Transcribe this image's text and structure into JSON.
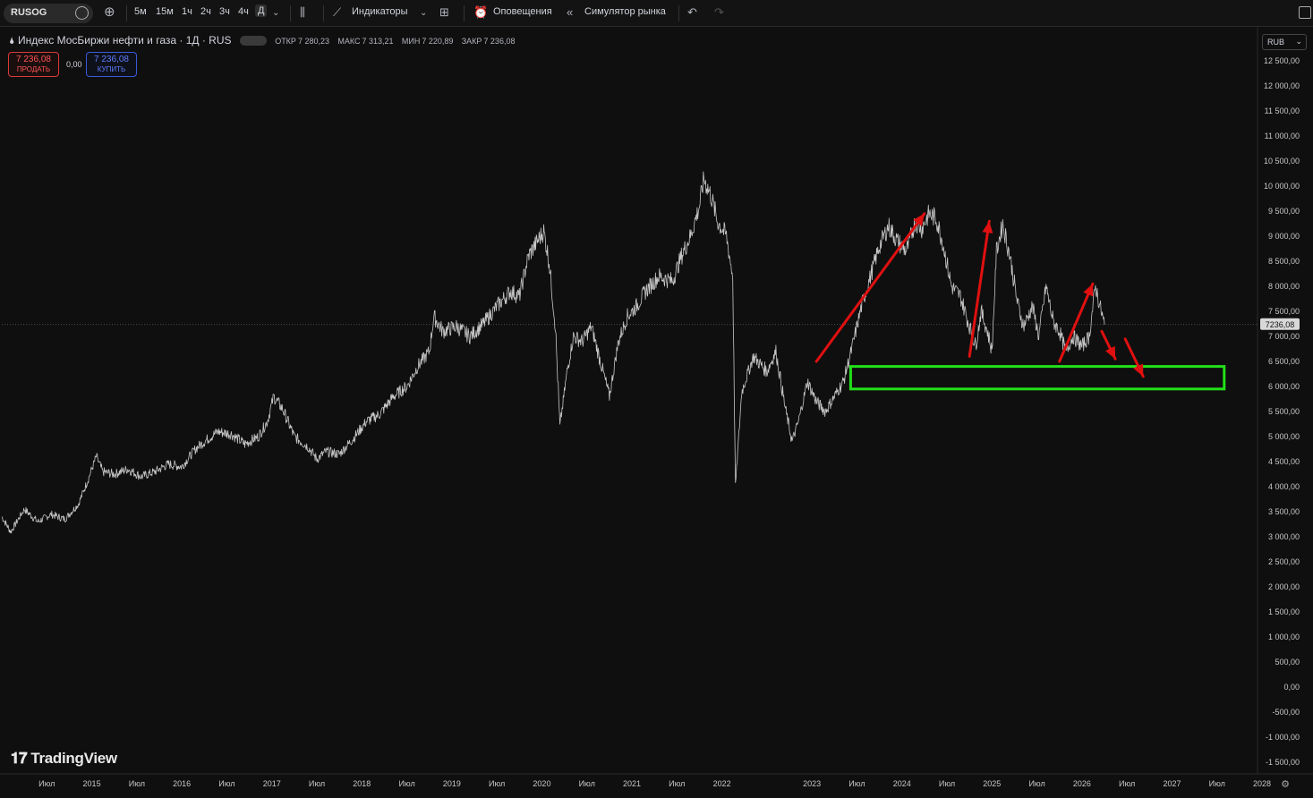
{
  "toolbar": {
    "symbol": "RUSOG",
    "intervals": [
      "5м",
      "15м",
      "1ч",
      "2ч",
      "3ч",
      "4ч",
      "Д"
    ],
    "active_interval": "Д",
    "indicators_label": "Индикаторы",
    "alerts_label": "Оповещения",
    "replay_label": "Симулятор рынка"
  },
  "legend": {
    "title": "Индекс МосБиржи нефти и газа · 1Д · RUS",
    "open_label": "ОТКР",
    "open": "7 280,23",
    "high_label": "МАКС",
    "high": "7 313,21",
    "low_label": "МИН",
    "low": "7 220,89",
    "close_label": "ЗАКР",
    "close": "7 236,08"
  },
  "trade": {
    "sell_price": "7 236,08",
    "sell_label": "ПРОДАТЬ",
    "spread": "0,00",
    "buy_price": "7 236,08",
    "buy_label": "КУПИТЬ"
  },
  "currency": "RUB",
  "brand": "TradingView",
  "colors": {
    "background": "#0f0f0f",
    "price_line": "#c8c8c8",
    "arrow": "#e01010",
    "zone": "#22e01a",
    "text": "#d1d4dc"
  },
  "chart_data": {
    "type": "line",
    "ylim": [
      -1500,
      12500
    ],
    "y_ticks": [
      "12 500,00",
      "12 000,00",
      "11 500,00",
      "11 000,00",
      "10 500,00",
      "10 000,00",
      "9 500,00",
      "9 000,00",
      "8 500,00",
      "8 000,00",
      "7 500,00",
      "7 000,00",
      "6 500,00",
      "6 000,00",
      "5 500,00",
      "5 000,00",
      "4 500,00",
      "4 000,00",
      "3 500,00",
      "3 000,00",
      "2 500,00",
      "2 000,00",
      "1 500,00",
      "1 000,00",
      "500,00",
      "0,00",
      "-500,00",
      "-1 000,00",
      "-1 500,00"
    ],
    "y_tick_values": [
      12500,
      12000,
      11500,
      11000,
      10500,
      10000,
      9500,
      9000,
      8500,
      8000,
      7500,
      7000,
      6500,
      6000,
      5500,
      5000,
      4500,
      4000,
      3500,
      3000,
      2500,
      2000,
      1500,
      1000,
      500,
      0,
      -500,
      -1000,
      -1500
    ],
    "x_ticks": [
      {
        "label": "Июл",
        "t": 2014.5
      },
      {
        "label": "2015",
        "t": 2015.0
      },
      {
        "label": "Июл",
        "t": 2015.5
      },
      {
        "label": "2016",
        "t": 2016.0
      },
      {
        "label": "Июл",
        "t": 2016.5
      },
      {
        "label": "2017",
        "t": 2017.0
      },
      {
        "label": "Июл",
        "t": 2017.5
      },
      {
        "label": "2018",
        "t": 2018.0
      },
      {
        "label": "Июл",
        "t": 2018.5
      },
      {
        "label": "2019",
        "t": 2019.0
      },
      {
        "label": "Июл",
        "t": 2019.5
      },
      {
        "label": "2020",
        "t": 2020.0
      },
      {
        "label": "Июл",
        "t": 2020.5
      },
      {
        "label": "2021",
        "t": 2021.0
      },
      {
        "label": "Июл",
        "t": 2021.5
      },
      {
        "label": "2022",
        "t": 2022.0
      },
      {
        "label": "2023",
        "t": 2023.0
      },
      {
        "label": "Июл",
        "t": 2023.5
      },
      {
        "label": "2024",
        "t": 2024.0
      },
      {
        "label": "Июл",
        "t": 2024.5
      },
      {
        "label": "2025",
        "t": 2025.0
      },
      {
        "label": "Июл",
        "t": 2025.5
      },
      {
        "label": "2026",
        "t": 2026.0
      },
      {
        "label": "Июл",
        "t": 2026.5
      },
      {
        "label": "2027",
        "t": 2027.0
      },
      {
        "label": "Июл",
        "t": 2027.5
      },
      {
        "label": "2028",
        "t": 2028.0
      }
    ],
    "current_price": 7236.08,
    "current_price_label": "7236,08",
    "series": [
      {
        "points": [
          [
            2014.0,
            3400
          ],
          [
            2014.1,
            3100
          ],
          [
            2014.25,
            3550
          ],
          [
            2014.4,
            3300
          ],
          [
            2014.55,
            3450
          ],
          [
            2014.7,
            3350
          ],
          [
            2014.85,
            3650
          ],
          [
            2014.95,
            4100
          ],
          [
            2015.05,
            4600
          ],
          [
            2015.12,
            4300
          ],
          [
            2015.25,
            4250
          ],
          [
            2015.4,
            4350
          ],
          [
            2015.55,
            4200
          ],
          [
            2015.7,
            4300
          ],
          [
            2015.85,
            4450
          ],
          [
            2016.0,
            4400
          ],
          [
            2016.15,
            4750
          ],
          [
            2016.25,
            4900
          ],
          [
            2016.4,
            5100
          ],
          [
            2016.55,
            5050
          ],
          [
            2016.7,
            4850
          ],
          [
            2016.85,
            5000
          ],
          [
            2016.95,
            5300
          ],
          [
            2017.02,
            5800
          ],
          [
            2017.12,
            5550
          ],
          [
            2017.25,
            5000
          ],
          [
            2017.4,
            4800
          ],
          [
            2017.5,
            4550
          ],
          [
            2017.6,
            4700
          ],
          [
            2017.75,
            4650
          ],
          [
            2017.9,
            4950
          ],
          [
            2018.05,
            5300
          ],
          [
            2018.2,
            5450
          ],
          [
            2018.35,
            5800
          ],
          [
            2018.5,
            6000
          ],
          [
            2018.62,
            6400
          ],
          [
            2018.75,
            6700
          ],
          [
            2018.8,
            7400
          ],
          [
            2018.9,
            7100
          ],
          [
            2019.05,
            7200
          ],
          [
            2019.2,
            7000
          ],
          [
            2019.35,
            7250
          ],
          [
            2019.5,
            7600
          ],
          [
            2019.65,
            7900
          ],
          [
            2019.75,
            7800
          ],
          [
            2019.85,
            8600
          ],
          [
            2019.95,
            8900
          ],
          [
            2020.02,
            9100
          ],
          [
            2020.08,
            8500
          ],
          [
            2020.15,
            7200
          ],
          [
            2020.2,
            5200
          ],
          [
            2020.28,
            6300
          ],
          [
            2020.35,
            7000
          ],
          [
            2020.45,
            6900
          ],
          [
            2020.55,
            7200
          ],
          [
            2020.65,
            6500
          ],
          [
            2020.75,
            5800
          ],
          [
            2020.85,
            6900
          ],
          [
            2020.95,
            7400
          ],
          [
            2021.05,
            7600
          ],
          [
            2021.15,
            7900
          ],
          [
            2021.3,
            8200
          ],
          [
            2021.45,
            8100
          ],
          [
            2021.55,
            8600
          ],
          [
            2021.65,
            9000
          ],
          [
            2021.75,
            9600
          ],
          [
            2021.8,
            10150
          ],
          [
            2021.88,
            9800
          ],
          [
            2021.95,
            9300
          ],
          [
            2022.05,
            9000
          ],
          [
            2022.12,
            8200
          ],
          [
            2022.15,
            4000
          ],
          [
            2022.22,
            5900
          ],
          [
            2022.35,
            6600
          ],
          [
            2022.5,
            6300
          ],
          [
            2022.6,
            6700
          ],
          [
            2022.7,
            5600
          ],
          [
            2022.78,
            4900
          ],
          [
            2022.85,
            5300
          ],
          [
            2022.95,
            6100
          ],
          [
            2023.05,
            5700
          ],
          [
            2023.15,
            5500
          ],
          [
            2023.25,
            5800
          ],
          [
            2023.35,
            6100
          ],
          [
            2023.45,
            6800
          ],
          [
            2023.55,
            7600
          ],
          [
            2023.65,
            8200
          ],
          [
            2023.75,
            8800
          ],
          [
            2023.85,
            9200
          ],
          [
            2023.95,
            8900
          ],
          [
            2024.05,
            8700
          ],
          [
            2024.15,
            9300
          ],
          [
            2024.22,
            9150
          ],
          [
            2024.3,
            9450
          ],
          [
            2024.38,
            9350
          ],
          [
            2024.45,
            8900
          ],
          [
            2024.55,
            8000
          ],
          [
            2024.65,
            7800
          ],
          [
            2024.75,
            7200
          ],
          [
            2024.82,
            6800
          ],
          [
            2024.88,
            7500
          ],
          [
            2024.95,
            7100
          ],
          [
            2025.0,
            6700
          ],
          [
            2025.05,
            8700
          ],
          [
            2025.12,
            9250
          ],
          [
            2025.2,
            8600
          ],
          [
            2025.28,
            7700
          ],
          [
            2025.35,
            7200
          ],
          [
            2025.45,
            7600
          ],
          [
            2025.52,
            7000
          ],
          [
            2025.6,
            8000
          ],
          [
            2025.68,
            7300
          ],
          [
            2025.75,
            7100
          ],
          [
            2025.82,
            6700
          ],
          [
            2025.9,
            7000
          ],
          [
            2026.0,
            6800
          ],
          [
            2026.08,
            7000
          ],
          [
            2026.15,
            8000
          ],
          [
            2026.2,
            7600
          ],
          [
            2026.25,
            7236
          ]
        ]
      }
    ]
  },
  "annotations": {
    "zone": {
      "t0": 2023.43,
      "t1": 2027.58,
      "y0": 5950,
      "y1": 6400
    },
    "arrows": [
      {
        "from": [
          2023.05,
          6500
        ],
        "to": [
          2024.25,
          9450
        ]
      },
      {
        "from": [
          2024.75,
          6600
        ],
        "to": [
          2024.97,
          9300
        ]
      },
      {
        "from": [
          2025.75,
          6500
        ],
        "to": [
          2026.12,
          8050
        ]
      },
      {
        "from": [
          2026.22,
          7100
        ],
        "to": [
          2026.37,
          6550
        ]
      },
      {
        "from": [
          2026.48,
          6950
        ],
        "to": [
          2026.68,
          6200
        ]
      }
    ]
  }
}
